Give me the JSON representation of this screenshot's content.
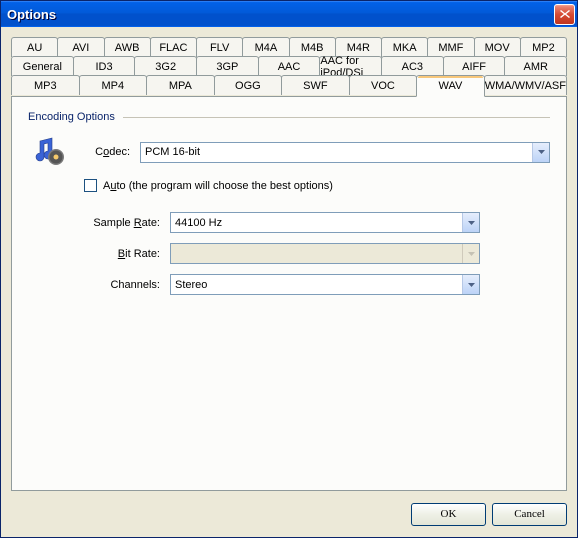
{
  "window": {
    "title": "Options"
  },
  "tabs": {
    "row1": [
      "AU",
      "AVI",
      "AWB",
      "FLAC",
      "FLV",
      "M4A",
      "M4B",
      "M4R",
      "MKA",
      "MMF",
      "MOV",
      "MP2"
    ],
    "row2": [
      "General",
      "ID3",
      "3G2",
      "3GP",
      "AAC",
      "AAC for iPod/DSi",
      "AC3",
      "AIFF",
      "AMR"
    ],
    "row3": [
      "MP3",
      "MP4",
      "MPA",
      "OGG",
      "SWF",
      "VOC",
      "WAV",
      "WMA/WMV/ASF"
    ],
    "active": "WAV"
  },
  "group": {
    "title": "Encoding Options"
  },
  "codec": {
    "label_pre": "C",
    "label_u": "o",
    "label_post": "dec:",
    "value": "PCM 16-bit"
  },
  "auto": {
    "label_pre": "A",
    "label_u": "u",
    "label_post": "to (the program will choose the best options)",
    "checked": false
  },
  "sample_rate": {
    "label_pre": "Sample ",
    "label_u": "R",
    "label_post": "ate:",
    "value": "44100 Hz"
  },
  "bit_rate": {
    "label_u": "B",
    "label_post": "it Rate:",
    "value": "",
    "enabled": false
  },
  "channels": {
    "label": "Channels:",
    "value": "Stereo"
  },
  "buttons": {
    "ok": "OK",
    "cancel": "Cancel"
  }
}
